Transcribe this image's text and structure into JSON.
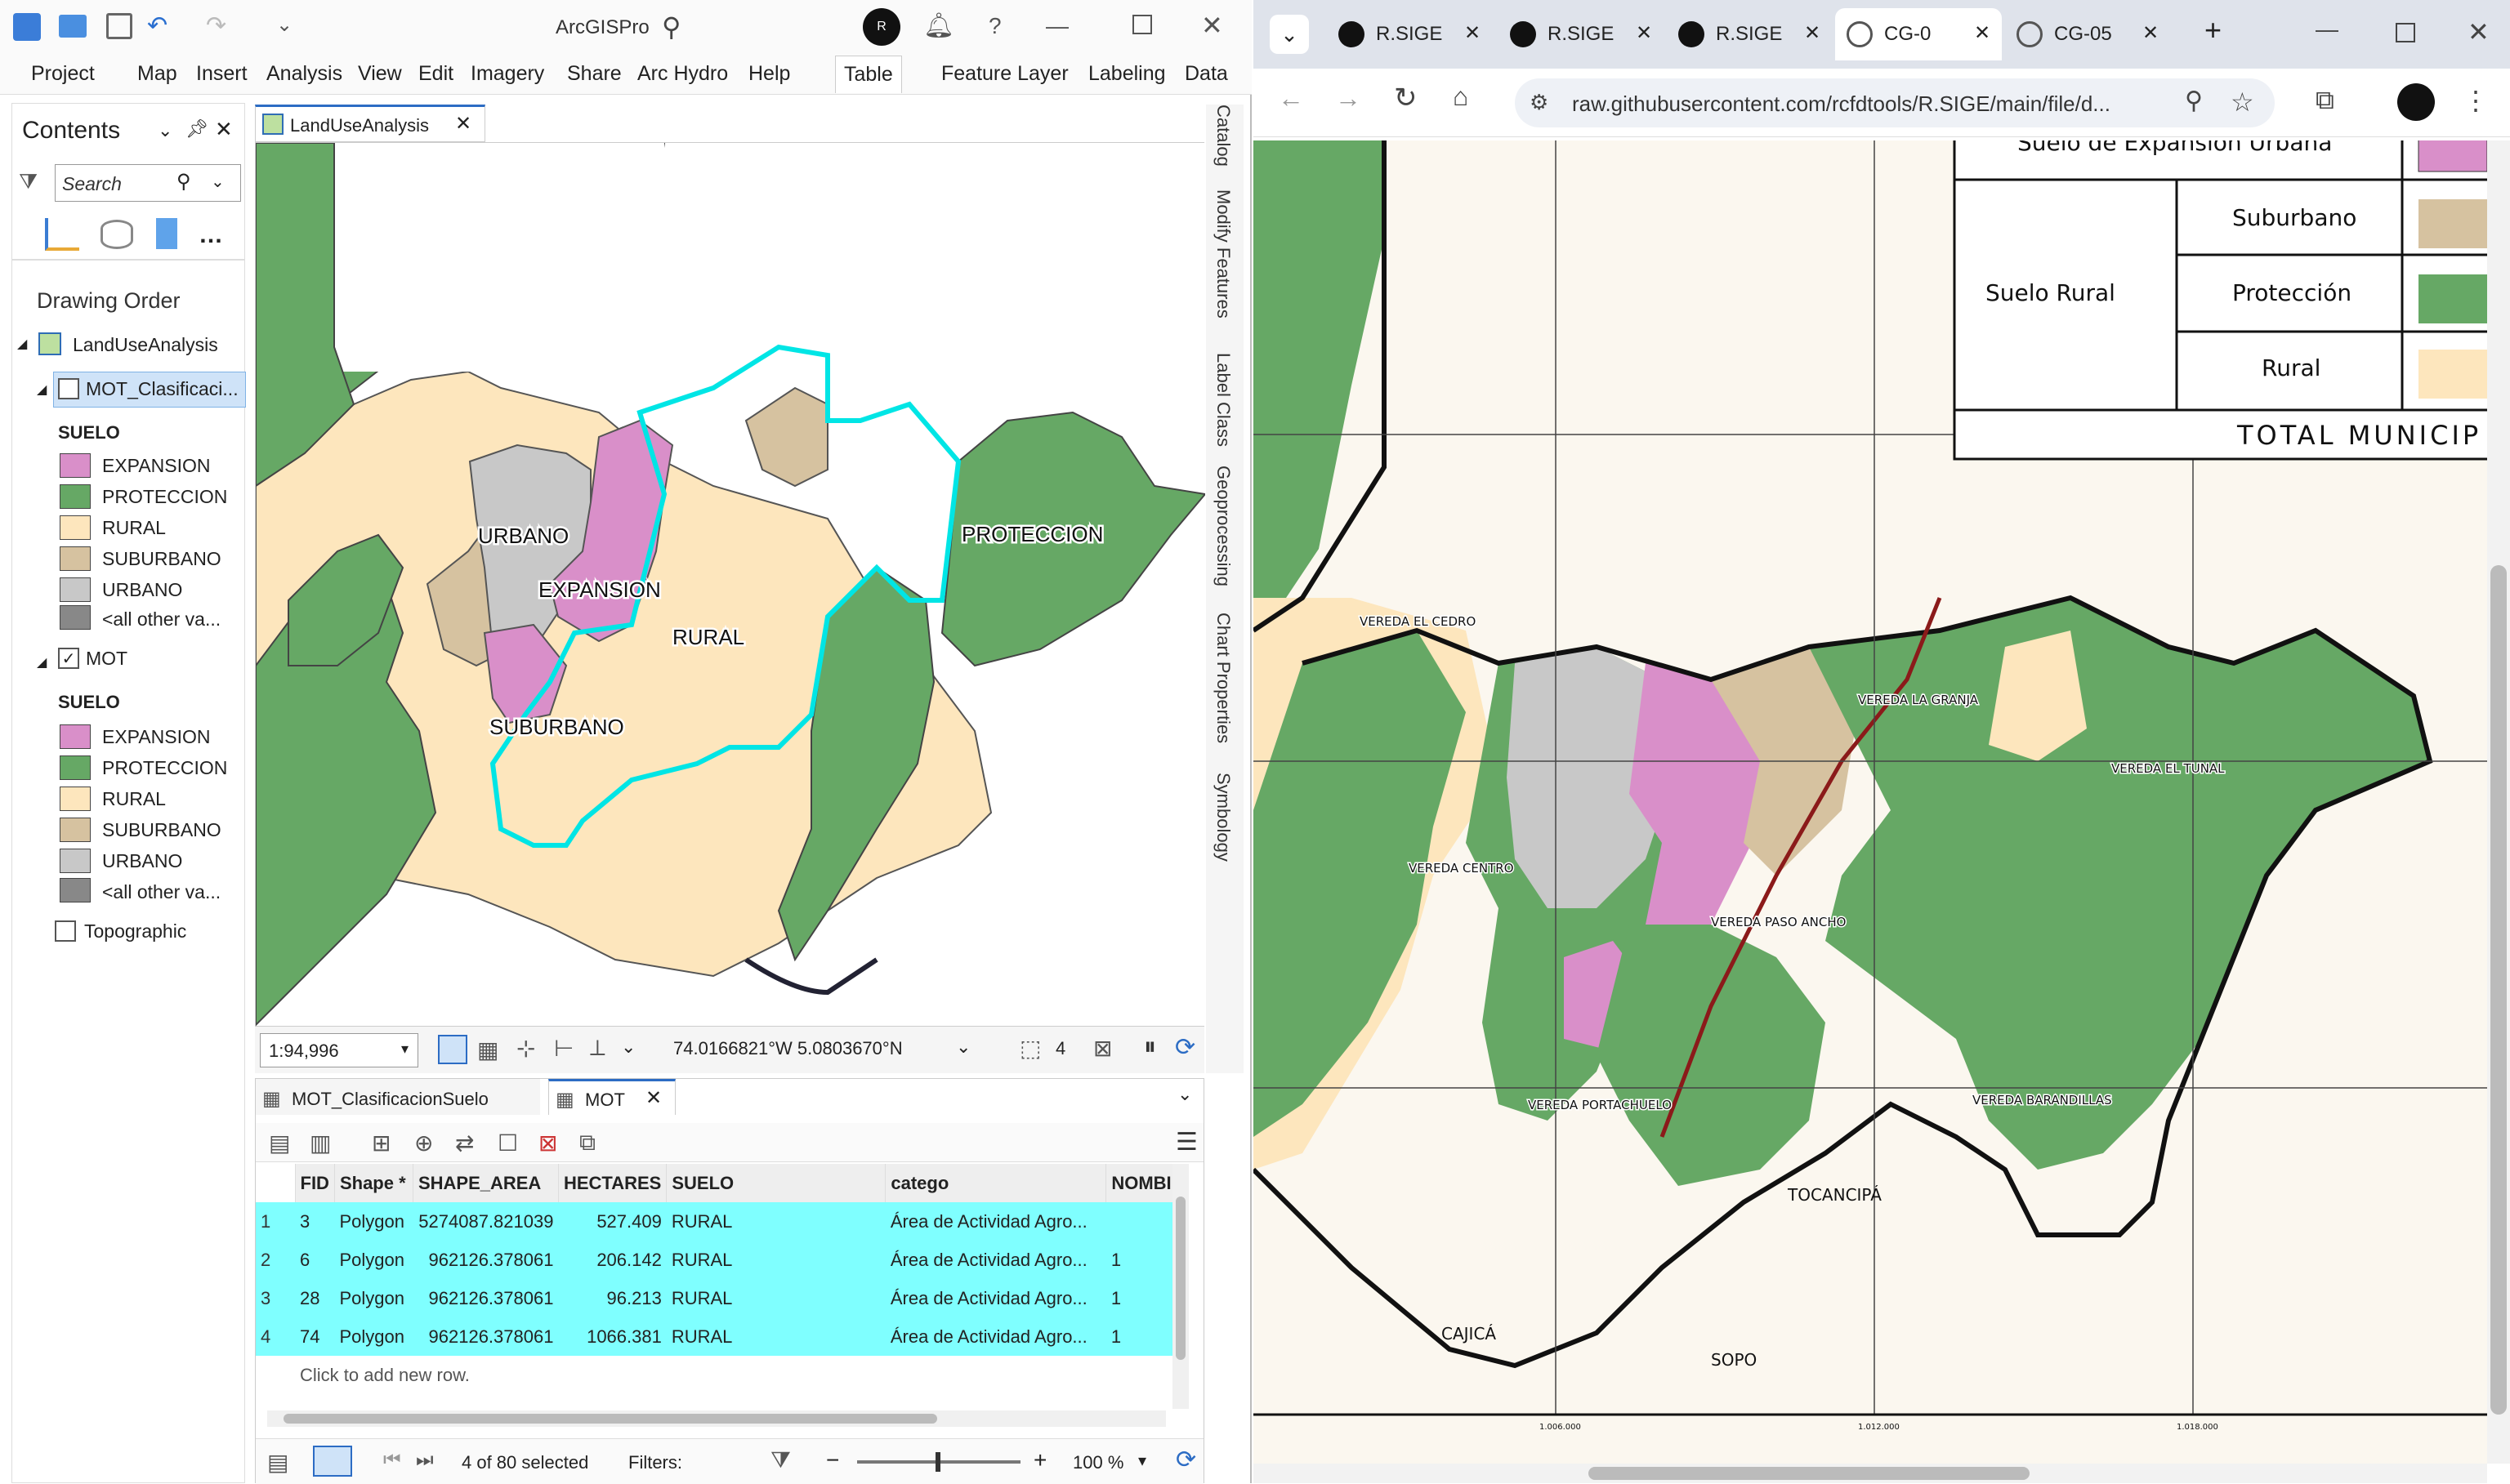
{
  "arcgis": {
    "title": "ArcGISPro",
    "ribbon_tabs": [
      "Project",
      "Map",
      "Insert",
      "Analysis",
      "View",
      "Edit",
      "Imagery",
      "Share",
      "Arc Hydro",
      "Help",
      "Table",
      "Feature Layer",
      "Labeling",
      "Data"
    ],
    "contents": {
      "title": "Contents",
      "search_placeholder": "Search",
      "drawing_order": "Drawing Order",
      "map_name": "LandUseAnalysis",
      "layer1": "MOT_Clasificaci...",
      "layer2": "MOT",
      "layer3": "Topographic",
      "group_label": "SUELO",
      "legend": [
        "EXPANSION",
        "PROTECCION",
        "RURAL",
        "SUBURBANO",
        "URBANO",
        "<all other va..."
      ]
    },
    "colors": {
      "expansion": "#d98fc9",
      "proteccion": "#66a865",
      "rural": "#fde6bd",
      "suburbano": "#d6c2a0",
      "urbano": "#c8c8c8",
      "other": "#888888",
      "sel": "#00e5e5"
    },
    "map": {
      "tab": "LandUseAnalysis",
      "labels": [
        "URBANO",
        "EXPANSION",
        "RURAL",
        "PROTECCION",
        "SUBURBANO"
      ],
      "scale": "1:94,996",
      "coords": "74.0166821°W 5.0803670°N",
      "sel_count": "4"
    },
    "vtabs": [
      "Catalog",
      "Modify Features",
      "Label Class",
      "Geoprocessing",
      "Chart Properties",
      "Symbology"
    ],
    "attr": {
      "tab1": "MOT_ClasificacionSuelo",
      "tab2": "MOT",
      "columns": [
        "FID",
        "Shape *",
        "SHAPE_AREA",
        "HECTARES",
        "SUELO",
        "catego",
        "NOMBI"
      ],
      "rows": [
        [
          "1",
          "3",
          "Polygon",
          "5274087.821039",
          "527.409",
          "RURAL",
          "Área de Actividad Agro...",
          ""
        ],
        [
          "2",
          "6",
          "Polygon",
          "962126.378061",
          "206.142",
          "RURAL",
          "Área de Actividad Agro...",
          "1"
        ],
        [
          "3",
          "28",
          "Polygon",
          "962126.378061",
          "96.213",
          "RURAL",
          "Área de Actividad Agro...",
          "1"
        ],
        [
          "4",
          "74",
          "Polygon",
          "962126.378061",
          "1066.381",
          "RURAL",
          "Área de Actividad Agro...",
          "1"
        ]
      ],
      "add_row": "Click to add new row.",
      "selected": "4 of 80 selected",
      "filters": "Filters:",
      "zoom": "100 %"
    }
  },
  "browser": {
    "tabs": [
      "R.SIGE",
      "R.SIGE",
      "R.SIGE",
      "CG-0",
      "CG-05"
    ],
    "url": "raw.githubusercontent.com/rcfdtools/R.SIGE/main/file/d...",
    "pdf": {
      "legend_top": "Suelo de Expansión Urbana",
      "rural_label": "Suelo Rural",
      "items": [
        "Suburbano",
        "Protección",
        "Rural"
      ],
      "total": "TOTAL MUNICIP",
      "veredas": [
        "VEREDA EL CEDRO",
        "VEREDA LA GRANJA",
        "VEREDA EL TUNAL",
        "VEREDA CENTRO",
        "VEREDA PASO ANCHO",
        "VEREDA PORTACHUELO",
        "VEREDA BARANDILLAS"
      ],
      "towns": [
        "TOCANCIPÁ",
        "CAJICÁ",
        "SOPO"
      ],
      "ticks": [
        "1.006.000",
        "1.012.000",
        "1.018.000"
      ]
    }
  }
}
